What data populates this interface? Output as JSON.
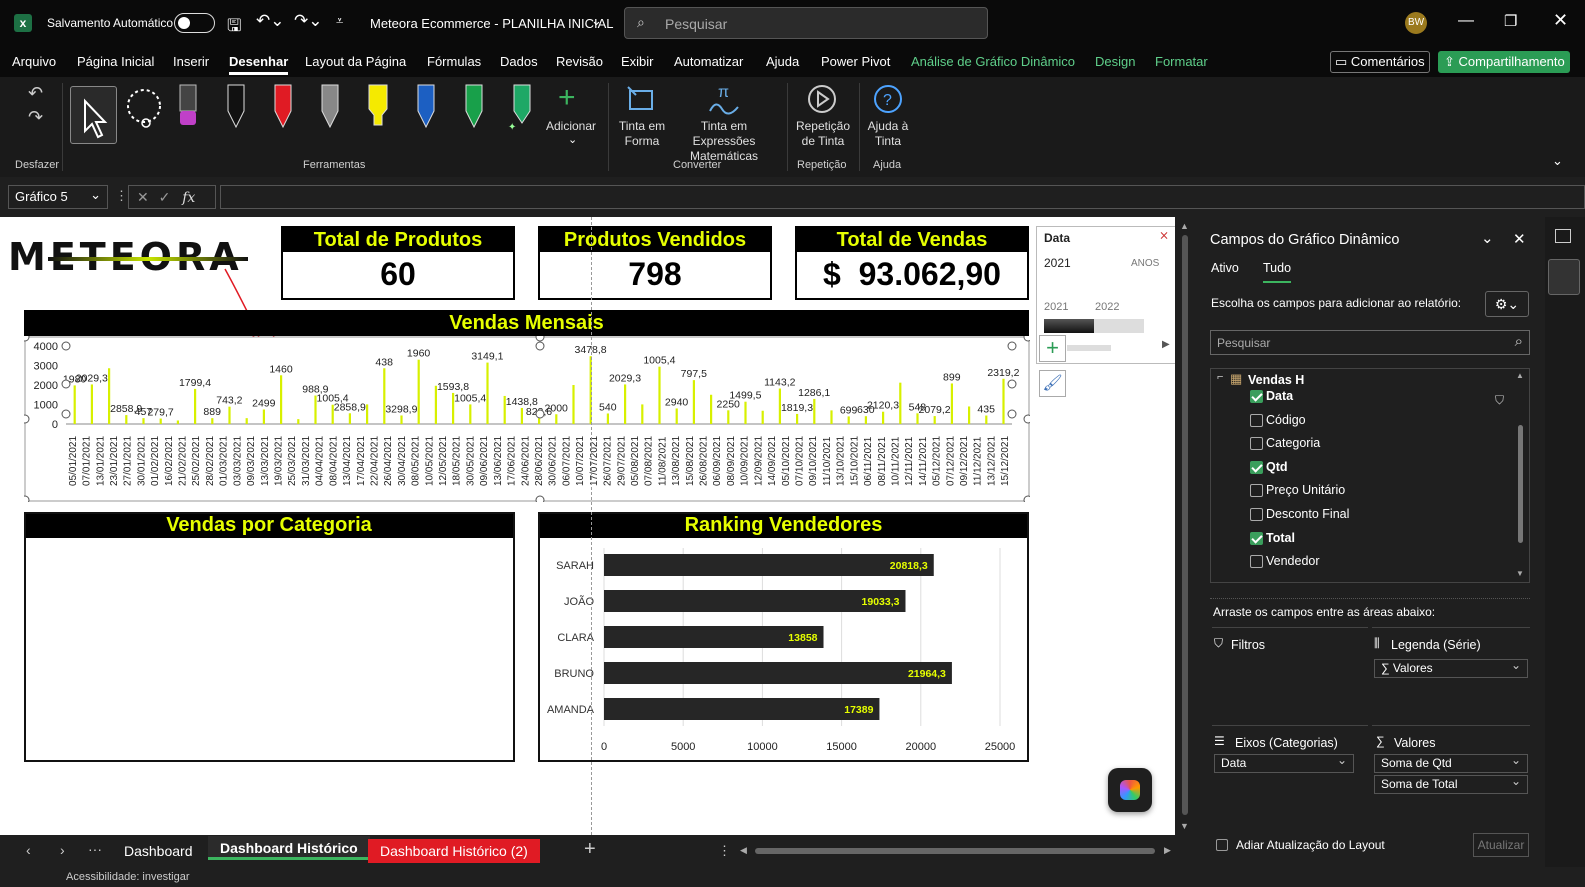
{
  "titlebar": {
    "autosave_label": "Salvamento Automático",
    "doc_title": "Meteora Ecommerce - PLANILHA INICIAL",
    "search_placeholder": "Pesquisar",
    "avatar": "BW"
  },
  "menu": {
    "items": [
      "Arquivo",
      "Página Inicial",
      "Inserir",
      "Desenhar",
      "Layout da Página",
      "Fórmulas",
      "Dados",
      "Revisão",
      "Exibir",
      "Automatizar",
      "Ajuda",
      "Power Pivot"
    ],
    "context_items": [
      "Análise de Gráfico Dinâmico",
      "Design",
      "Formatar"
    ],
    "comments": "Comentários",
    "share": "Compartilhamento"
  },
  "ribbon": {
    "undo_group": "Desfazer",
    "tools_group": "Ferramentas",
    "add_label": "Adicionar",
    "ink_shape": "Tinta em Forma",
    "ink_math": "Tinta em Expressões Matemáticas",
    "convert_group": "Converter",
    "ink_replay": "Repetição de Tinta",
    "replay_group": "Repetição",
    "ink_help": "Ajuda à Tinta",
    "help_group": "Ajuda"
  },
  "formula": {
    "name_box": "Gráfico 5",
    "fx": "fx"
  },
  "dashboard": {
    "logo": "METEORA",
    "kpis": [
      {
        "title": "Total de Produtos",
        "value": "60"
      },
      {
        "title": "Produtos Vendidos",
        "value": "798"
      },
      {
        "title": "Total de Vendas",
        "value": "$  93.062,90"
      }
    ],
    "timeline": {
      "field": "Data",
      "period": "2021",
      "level": "ANOS",
      "years": [
        "2021",
        "2022"
      ]
    },
    "monthly_title": "Vendas Mensais",
    "category_title": "Vendas por Categoria",
    "ranking_title": "Ranking Vendedores"
  },
  "chart_data": [
    {
      "type": "bar",
      "title": "Vendas Mensais",
      "ylim": [
        0,
        4000
      ],
      "yticks": [
        0,
        1000,
        2000,
        3000,
        4000
      ],
      "x": [
        "05/01/2021",
        "07/01/2021",
        "13/01/2021",
        "23/01/2021",
        "27/01/2021",
        "30/01/2021",
        "01/02/2021",
        "16/02/2021",
        "21/02/2021",
        "25/02/2021",
        "28/02/2021",
        "01/03/2021",
        "03/03/2021",
        "09/03/2021",
        "13/03/2021",
        "19/03/2021",
        "25/03/2021",
        "31/03/2021",
        "04/04/2021",
        "08/04/2021",
        "13/04/2021",
        "17/04/2021",
        "22/04/2021",
        "26/04/2021",
        "30/04/2021",
        "08/05/2021",
        "10/05/2021",
        "12/05/2021",
        "18/05/2021",
        "30/05/2021",
        "09/06/2021",
        "13/06/2021",
        "17/06/2021",
        "24/06/2021",
        "28/06/2021",
        "30/06/2021",
        "06/07/2021",
        "10/07/2021",
        "17/07/2021",
        "26/07/2021",
        "29/07/2021",
        "05/08/2021",
        "07/08/2021",
        "11/08/2021",
        "13/08/2021",
        "15/08/2021",
        "26/08/2021",
        "06/09/2021",
        "08/09/2021",
        "10/09/2021",
        "12/09/2021",
        "14/09/2021",
        "05/10/2021",
        "07/10/2021",
        "09/10/2021",
        "11/10/2021",
        "13/10/2021",
        "15/10/2021",
        "06/11/2021",
        "08/11/2021",
        "10/11/2021",
        "12/11/2021",
        "14/11/2021",
        "05/12/2021",
        "07/12/2021",
        "09/12/2021",
        "11/12/2021",
        "13/12/2021",
        "15/12/2021"
      ],
      "values": [
        1980,
        2029.3,
        2858.9,
        457,
        300,
        279.7,
        180,
        1799.4,
        300,
        889,
        300,
        743.2,
        2499,
        250,
        1460,
        988.9,
        550,
        1005.4,
        2858.9,
        438,
        3298.9,
        1960,
        1593.8,
        1005.4,
        3149.1,
        1438.8,
        822.6,
        300,
        500,
        2000,
        3478.8,
        540,
        2029.3,
        1005.4,
        2940,
        797.5,
        2250,
        1499.5,
        702,
        1143.2,
        679.8,
        1819.3,
        515.9,
        1286.1,
        699,
        390,
        400,
        630,
        2120.3,
        548,
        406,
        2079.2,
        899,
        435,
        2319.2
      ],
      "labels": [
        "1980",
        "2029,3",
        "2858,9",
        "457",
        "279,7",
        "1799,4",
        "889",
        "743,2",
        "2499",
        "1460",
        "988,9",
        "1005,4",
        "2858,9",
        "438",
        "3298,9",
        "1960",
        "1593,8",
        "1005,4",
        "3149,1",
        "1438,8",
        "822,6",
        "2000",
        "3478,8",
        "540",
        "2029,3",
        "1005,4",
        "2940",
        "797,5",
        "2250",
        "1499,5",
        "1143,2",
        "1819,3",
        "1286,1",
        "699",
        "630",
        "2120,3",
        "548",
        "2079,2",
        "899",
        "435",
        "2319,2"
      ]
    },
    {
      "type": "bar",
      "orientation": "horizontal",
      "title": "Ranking Vendedores",
      "categories": [
        "SARAH",
        "JOÃO",
        "CLARA",
        "BRUNO",
        "AMANDA"
      ],
      "values": [
        20818.3,
        19033.3,
        13858,
        21964.3,
        17389
      ],
      "value_labels": [
        "20818,3",
        "19033,3",
        "13858",
        "21964,3",
        "17389"
      ],
      "xlim": [
        0,
        25000
      ],
      "xticks": [
        "0",
        "5000",
        "10000",
        "15000",
        "20000",
        "25000"
      ],
      "bar_color": "#262626",
      "label_color": "#e6ff00"
    }
  ],
  "pane": {
    "title": "Campos do Gráfico Dinâmico",
    "tab_active": "Tudo",
    "tab_other": "Ativo",
    "instruction": "Escolha os campos para adicionar ao relatório:",
    "search_placeholder": "Pesquisar",
    "table_name": "Vendas H",
    "fields": [
      {
        "name": "Data",
        "checked": true
      },
      {
        "name": "Código",
        "checked": false
      },
      {
        "name": "Categoria",
        "checked": false
      },
      {
        "name": "Qtd",
        "checked": true
      },
      {
        "name": "Preço Unitário",
        "checked": false
      },
      {
        "name": "Desconto Final",
        "checked": false
      },
      {
        "name": "Total",
        "checked": true
      },
      {
        "name": "Vendedor",
        "checked": false
      }
    ],
    "drag_text": "Arraste os campos entre as áreas abaixo:",
    "filters": "Filtros",
    "legend": "Legenda (Série)",
    "legend_value": "∑ Valores",
    "axes": "Eixos (Categorias)",
    "axes_value": "Data",
    "values": "Valores",
    "values_items": [
      "Soma de Qtd",
      "Soma de Total"
    ],
    "defer": "Adiar Atualização do Layout",
    "update": "Atualizar"
  },
  "sheets": [
    "Dashboard",
    "Dashboard Histórico",
    "Dashboard Histórico (2)"
  ],
  "status": {
    "accessibility": "Acessibilidade: investigar"
  }
}
